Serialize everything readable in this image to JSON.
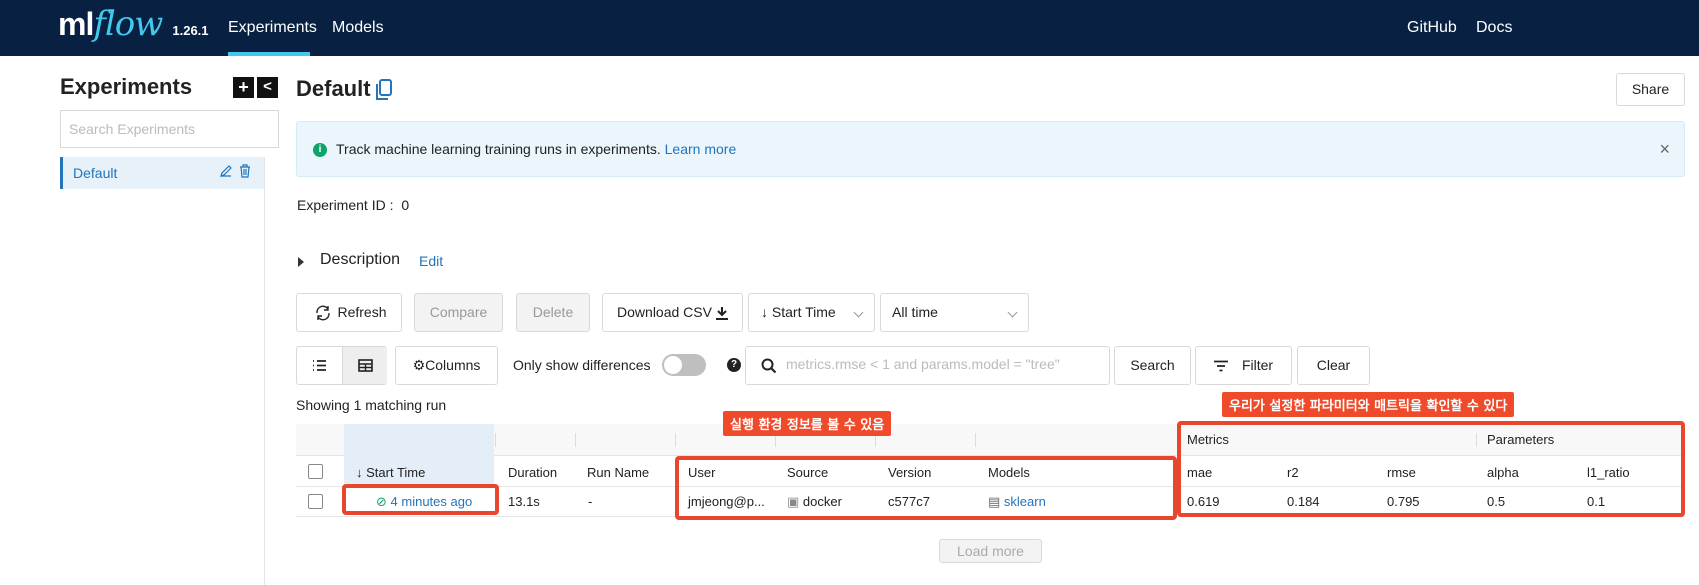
{
  "header": {
    "logo_ml": "ml",
    "logo_flow": "flow",
    "version": "1.26.1",
    "tabs": [
      {
        "label": "Experiments",
        "active": true
      },
      {
        "label": "Models",
        "active": false
      }
    ],
    "right_links": [
      "GitHub",
      "Docs"
    ]
  },
  "sidebar": {
    "title": "Experiments",
    "add_label": "+",
    "collapse_label": "<",
    "search_placeholder": "Search Experiments",
    "items": [
      {
        "label": "Default",
        "selected": true
      }
    ]
  },
  "main": {
    "title": "Default",
    "share_label": "Share",
    "banner": {
      "text": "Track machine learning training runs in experiments.",
      "link": "Learn more",
      "close": "×"
    },
    "experiment_id_label": "Experiment ID :",
    "experiment_id": "0",
    "description_label": "Description",
    "edit_label": "Edit",
    "toolbar": {
      "refresh": "Refresh",
      "compare": "Compare",
      "delete": "Delete",
      "download_csv": "Download CSV",
      "sort": "Start Time",
      "time_range": "All time",
      "columns": "Columns",
      "only_show_differences": "Only show differences",
      "search_placeholder": "metrics.rmse < 1 and params.model = \"tree\"",
      "search": "Search",
      "filter": "Filter",
      "clear": "Clear"
    },
    "showing_text": "Showing 1 matching run",
    "table": {
      "group_headers": {
        "metrics": "Metrics",
        "parameters": "Parameters"
      },
      "columns": [
        "Start Time",
        "Duration",
        "Run Name",
        "User",
        "Source",
        "Version",
        "Models",
        "mae",
        "r2",
        "rmse",
        "alpha",
        "l1_ratio"
      ],
      "sort_arrow": "↓",
      "rows": [
        {
          "start_time": "4 minutes ago",
          "duration": "13.1s",
          "run_name": "-",
          "user": "jmjeong@p...",
          "source": "docker",
          "version": "c577c7",
          "models": "sklearn",
          "mae": "0.619",
          "r2": "0.184",
          "rmse": "0.795",
          "alpha": "0.5",
          "l1_ratio": "0.1"
        }
      ]
    },
    "load_more": "Load more"
  },
  "annotations": {
    "env_label": "실행 환경 정보를 볼 수 있음",
    "metrics_label": "우리가 설정한 파라미터와 매트릭을 확인할 수 있다",
    "color": "#e9472d"
  },
  "colors": {
    "header_bg": "#082142",
    "accent": "#43c9ed",
    "link": "#2374bb",
    "success": "#0fa36b"
  }
}
